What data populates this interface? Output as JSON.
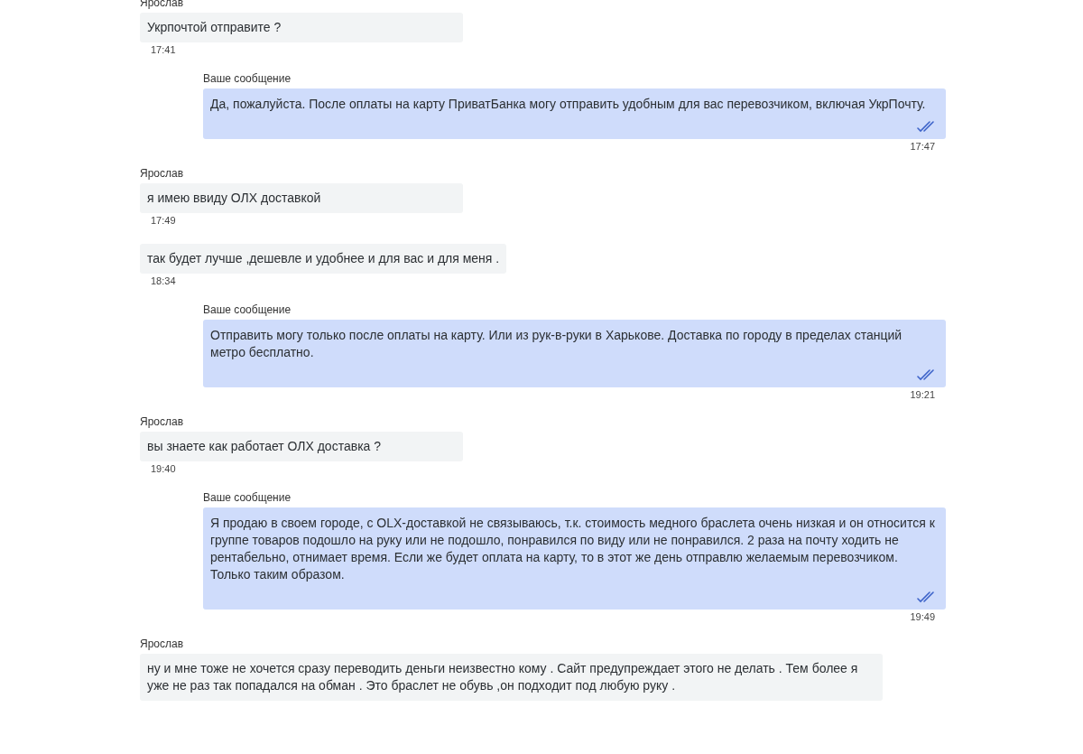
{
  "messages": [
    {
      "kind": "incoming",
      "sender": "Ярослав",
      "text": "Укрпочтой отправите ?",
      "time": "17:41"
    },
    {
      "kind": "outgoing",
      "sender": "Ваше сообщение",
      "text": "Да, пожалуйста. После оплаты на карту ПриватБанка могу отправить удобным для вас перевозчиком, включая УкрПочту.",
      "time": "17:47",
      "read": true
    },
    {
      "kind": "incoming",
      "sender": "Ярослав",
      "text": "я имею ввиду ОЛХ доставкой",
      "time": "17:49"
    },
    {
      "kind": "incoming",
      "text": "так будет лучше ,дешевле и удобнее и для вас и для меня .",
      "time": "18:34"
    },
    {
      "kind": "outgoing",
      "sender": "Ваше сообщение",
      "text": "Отправить могу только после оплаты на карту. Или из рук-в-руки в Харькове. Доставка по городу в пределах станций метро бесплатно.",
      "time": "19:21",
      "read": true
    },
    {
      "kind": "incoming",
      "sender": "Ярослав",
      "text": "вы знаете как работает ОЛХ доставка ?",
      "time": "19:40"
    },
    {
      "kind": "outgoing",
      "sender": "Ваше сообщение",
      "text": "Я продаю в своем городе, с OLX-доставкой не связываюсь, т.к. стоимость медного браслета очень низкая и он относится к группе товаров подошло на руку или не подошло, понравился по виду или не понравился. 2 раза на почту ходить не рентабельно, отнимает время. Если же будет оплата на карту, то в этот же день отправлю желаемым перевозчиком. Только таким образом.",
      "time": "19:49",
      "read": true
    },
    {
      "kind": "incoming",
      "sender": "Ярослав",
      "text": "ну и мне тоже не хочется сразу переводить деньги неизвестно кому . Сайт предупреждает этого не делать . Тем более я уже не раз так попадался на обман . Это браслет не обувь ,он подходит под любую руку ."
    }
  ]
}
